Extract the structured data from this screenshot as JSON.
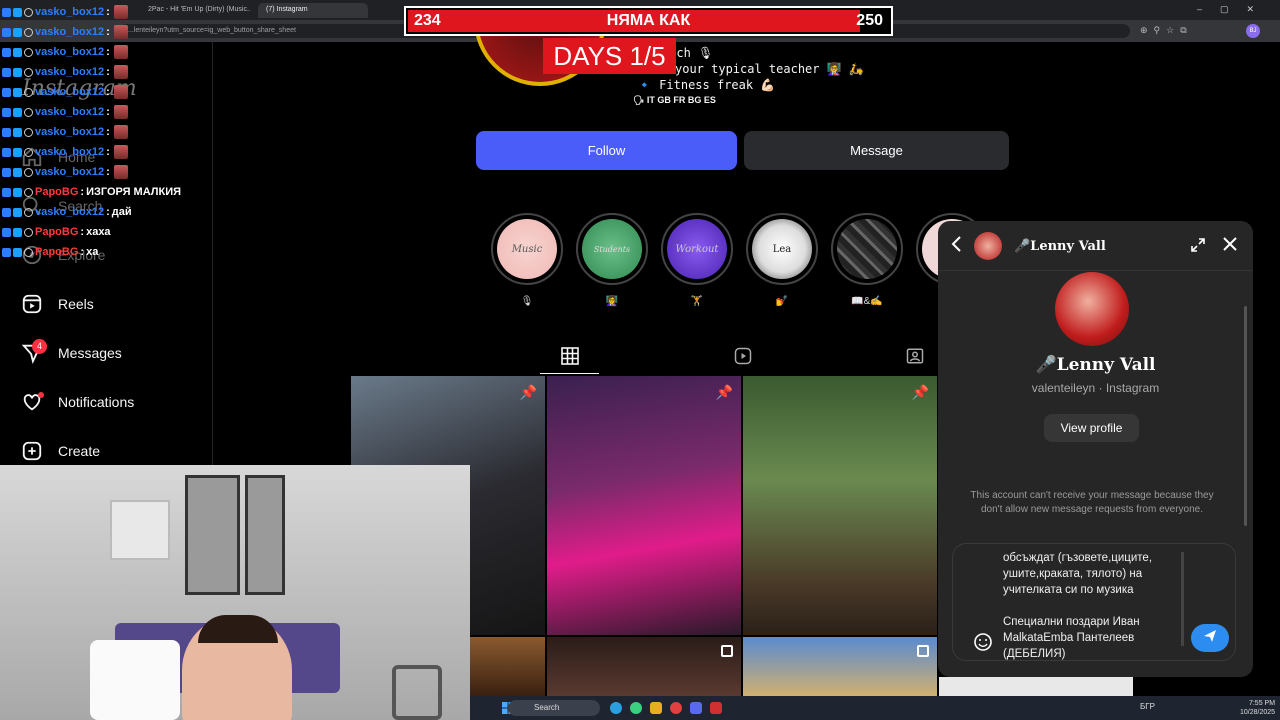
{
  "browser": {
    "tabs": [
      "2Pac - Hit 'Em Up (Dirty) (Music...",
      "(7) Instagram"
    ],
    "url": "...lenteileyn?utm_source=ig_web_button_share_sheet",
    "profile_initials": "BJ"
  },
  "sidebar": {
    "logo": "Instagram",
    "items": [
      {
        "label": "Home",
        "icon": "home-icon"
      },
      {
        "label": "Search",
        "icon": "search-icon"
      },
      {
        "label": "Explore",
        "icon": "compass-icon"
      },
      {
        "label": "Reels",
        "icon": "reels-icon"
      },
      {
        "label": "Messages",
        "icon": "messenger-icon",
        "badge": "4"
      },
      {
        "label": "Notifications",
        "icon": "heart-icon"
      },
      {
        "label": "Create",
        "icon": "plus-icon"
      }
    ]
  },
  "chat": [
    {
      "user": "vasko_box12",
      "sep": ":",
      "msg": "",
      "color": "blue"
    },
    {
      "user": "vasko_box12",
      "sep": ":",
      "msg": "",
      "color": "blue"
    },
    {
      "user": "vasko_box12",
      "sep": ":",
      "msg": "",
      "color": "blue"
    },
    {
      "user": "vasko_box12",
      "sep": ":",
      "msg": "",
      "color": "blue"
    },
    {
      "user": "vasko_box12",
      "sep": ":",
      "msg": "",
      "color": "blue"
    },
    {
      "user": "vasko_box12",
      "sep": ":",
      "msg": "",
      "color": "blue"
    },
    {
      "user": "vasko_box12",
      "sep": ":",
      "msg": "",
      "color": "blue"
    },
    {
      "user": "vasko_box12",
      "sep": ":",
      "msg": "",
      "color": "blue"
    },
    {
      "user": "vasko_box12",
      "sep": ":",
      "msg": "",
      "color": "blue"
    },
    {
      "user": "PapoBG",
      "sep": ":",
      "msg": "ИЗГОРЯ МАЛКИЯ",
      "color": "red"
    },
    {
      "user": "vasko_box12",
      "sep": ":",
      "msg": "дай",
      "color": "blue"
    },
    {
      "user": "PapoBG",
      "sep": ":",
      "msg": "хаха",
      "color": "red"
    },
    {
      "user": "PapoBG",
      "sep": ":",
      "msg": "ха",
      "color": "red"
    }
  ],
  "banner": {
    "left": "234",
    "title": "НЯМА КАК",
    "right": "250",
    "days": "DAYS  1/5"
  },
  "profile": {
    "bio": [
      "al coach 🎙",
      "your typical teacher 👩‍🏫 🛵",
      "🔹 Fitness freak 💪🏻",
      "🗣 IT GB FR BG ES"
    ],
    "follow_label": "Follow",
    "message_label": "Message",
    "highlights": [
      {
        "title": "Music",
        "label": "🎙",
        "color": "#f3c3c0"
      },
      {
        "title": "Students",
        "label": "👩‍🏫",
        "color": "#4aa86a"
      },
      {
        "title": "Workout",
        "label": "🏋",
        "color": "#6a3fd0"
      },
      {
        "title": "Lea",
        "label": "💅",
        "color": "#ccc"
      },
      {
        "title": "",
        "label": "📖&✍",
        "color": "#333"
      }
    ]
  },
  "dm": {
    "header_name": "🎤Lenny Vall",
    "big_name": "🎤Lenny Vall",
    "subtitle": "valenteileyn · Instagram",
    "view_profile": "View profile",
    "notice": "This account can't receive your message because they don't allow new message requests from everyone.",
    "draft": "обсъждат (гъзовете,циците,\nушите,краката, тялото) на\nучителката си по музика\n\nСпециални поздари Иван\nMalkataEmba Пантелеев\n(ДЕБЕЛИЯ)"
  },
  "taskbar": {
    "search": "Search",
    "tray": "БГР",
    "time": "7:55 PM",
    "date": "10/28/2025"
  }
}
